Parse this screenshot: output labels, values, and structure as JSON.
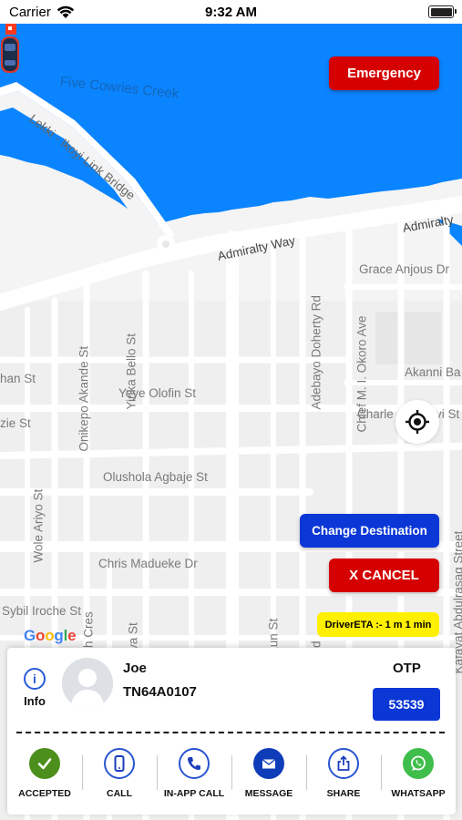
{
  "status_bar": {
    "carrier": "Carrier",
    "time": "9:32 AM"
  },
  "map": {
    "water_label": "Five Cowries Creek",
    "streets": [
      "Lekki - Ikoyi Link Bridge",
      "Admiralty Way",
      "Admiralty",
      "Grace Anjous Dr",
      "Akanni Ba",
      "Charle",
      "vi St",
      "Yeye Olofin St",
      "Olushola Agbaje St",
      "Chris Madueke Dr",
      "Sybil Iroche St",
      "Onikepo Akande St",
      "Yinka Bello St",
      "Adebayo Doherty Rd",
      "Chief M. I. Okoro Ave",
      "Wole Ariyo St",
      "han St",
      "zie St",
      "ogoh Cres",
      "-Silva St",
      "ashaun St",
      "ne Rd",
      "Kafayat Abdulrasag Street"
    ],
    "attribution": "Google"
  },
  "buttons": {
    "emergency": "Emergency",
    "change_destination": "Change Destination",
    "cancel": "X CANCEL"
  },
  "eta": "DriverETA :- 1 m 1 min",
  "driver": {
    "info_label": "Info",
    "name": "Joe",
    "vehicle_number": "TN64A0107",
    "otp_label": "OTP",
    "otp": "53539"
  },
  "actions": [
    {
      "label": "ACCEPTED",
      "icon": "check-icon"
    },
    {
      "label": "CALL",
      "icon": "phone-device-icon"
    },
    {
      "label": "IN-APP CALL",
      "icon": "phone-handset-icon"
    },
    {
      "label": "MESSAGE",
      "icon": "envelope-icon"
    },
    {
      "label": "SHARE",
      "icon": "share-icon"
    },
    {
      "label": "WHATSAPP",
      "icon": "whatsapp-icon"
    }
  ],
  "colors": {
    "water": "#0a84ff",
    "emergency": "#d50000",
    "primary_blue": "#0b37d6",
    "eta_yellow": "#ffef00",
    "accepted_green": "#4d8f1c",
    "whatsapp_green": "#3fbe4b"
  }
}
